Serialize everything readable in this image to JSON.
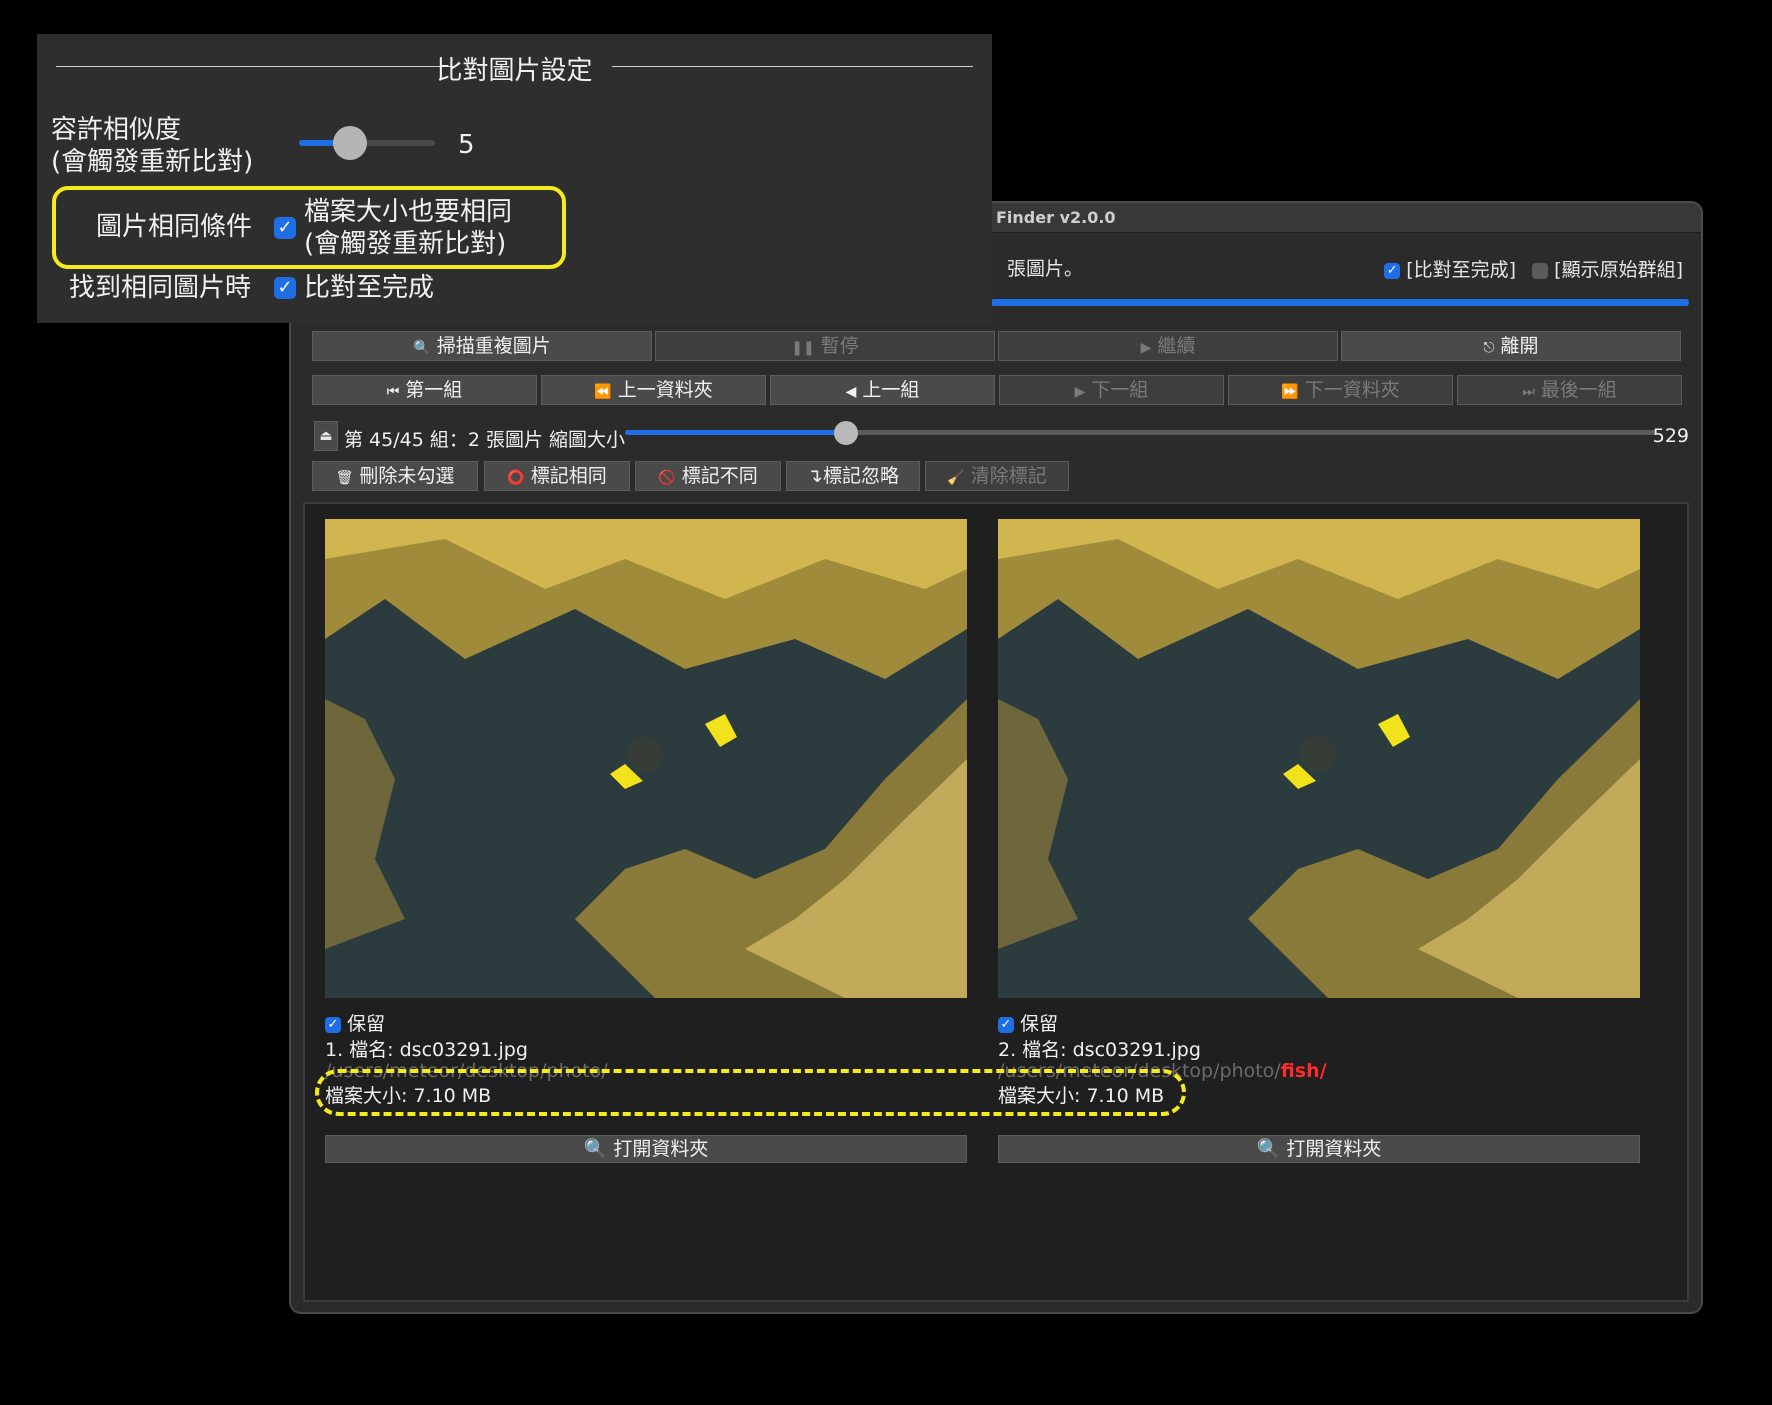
{
  "window": {
    "title": "Finder v2.0.0",
    "status_text": "張圖片。",
    "check_complete": {
      "label": "[比對至完成]",
      "checked": true
    },
    "check_show_groups": {
      "label": "[顯示原始群組]",
      "checked": false
    },
    "progress": 1.0
  },
  "toolbar_row1": [
    {
      "icon": "magnifier-icon",
      "label": "掃描重複圖片",
      "enabled": true
    },
    {
      "icon": "pause-icon",
      "label": "暫停",
      "enabled": false
    },
    {
      "icon": "play-icon",
      "label": "繼續",
      "enabled": false
    },
    {
      "icon": "exit-icon",
      "label": "離開",
      "enabled": true
    }
  ],
  "toolbar_row2": [
    {
      "icon": "first-icon",
      "label": "第一組",
      "enabled": true
    },
    {
      "icon": "rewind-icon",
      "label": "上一資料夾",
      "enabled": true
    },
    {
      "icon": "prev-icon",
      "label": "上一組",
      "enabled": true
    },
    {
      "icon": "next-icon",
      "label": "下一組",
      "enabled": false
    },
    {
      "icon": "fast-forward-icon",
      "label": "下一資料夾",
      "enabled": false
    },
    {
      "icon": "last-icon",
      "label": "最後一組",
      "enabled": false
    }
  ],
  "group_bar": {
    "label": "第 45/45 組：2 張圖片 縮圖大小",
    "thumb_size": "529"
  },
  "toolbar_row3": [
    {
      "icon": "trash-icon",
      "label": "刪除未勾選",
      "enabled": true
    },
    {
      "icon": "circle-icon",
      "label": "標記相同",
      "enabled": true
    },
    {
      "icon": "prohibit-icon",
      "label": "標記不同",
      "enabled": true
    },
    {
      "icon": "arrow-icon",
      "label": "↴標記忽略",
      "enabled": true
    },
    {
      "icon": "broom-icon",
      "label": "清除標記",
      "enabled": false
    }
  ],
  "images": [
    {
      "keep_label": "保留",
      "name": "1. 檔名: dsc03291.jpg",
      "path": "/users/meteor/desktop/photo/",
      "path_extra": "",
      "size": "檔案大小: 7.10 MB",
      "open_label": "打開資料夾"
    },
    {
      "keep_label": "保留",
      "name": "2. 檔名: dsc03291.jpg",
      "path": "/users/meteor/desktop/photo/",
      "path_extra": "fish/",
      "size": "檔案大小: 7.10 MB",
      "open_label": "打開資料夾"
    }
  ],
  "settings": {
    "title": "比對圖片設定",
    "similarity_label_1": "容許相似度",
    "similarity_label_2": "(會觸發重新比對)",
    "similarity_value": "5",
    "same_cond_label": "圖片相同條件",
    "same_size_label_1": "檔案大小也要相同",
    "same_size_label_2": "(會觸發重新比對)",
    "found_label": "找到相同圖片時",
    "complete_label": "比對至完成"
  },
  "colors": {
    "accent": "#1e6fe6",
    "highlight": "#f4ea1c",
    "path_red": "#ff2a2a"
  }
}
